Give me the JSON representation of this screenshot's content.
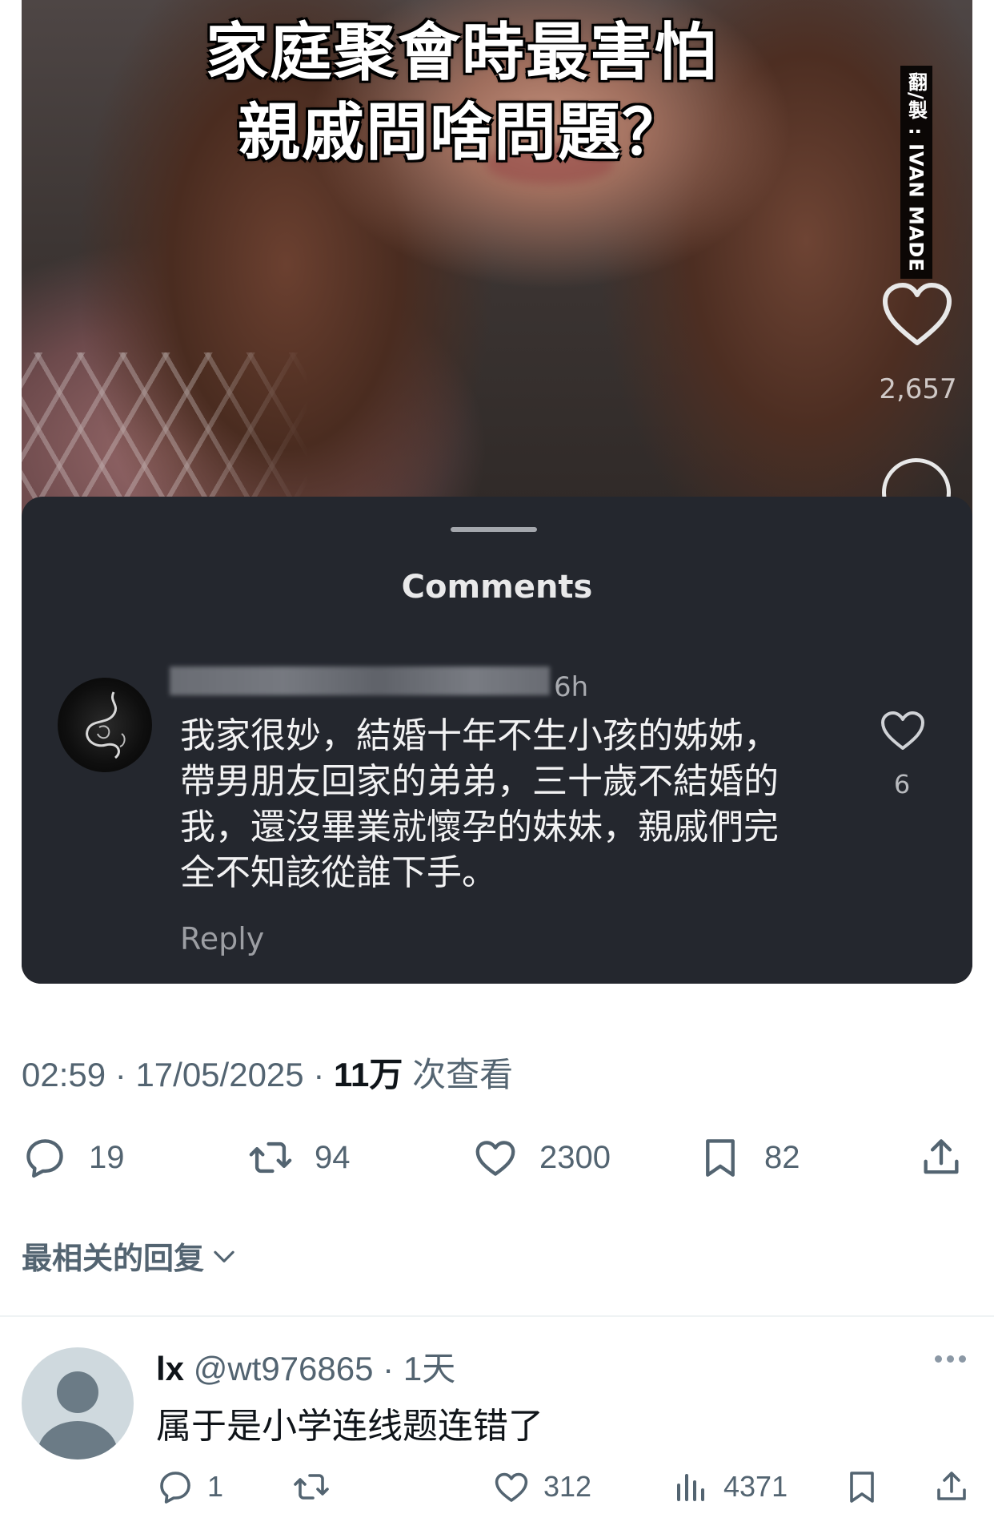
{
  "media": {
    "headline_line1": "家庭聚會時最害怕",
    "headline_line2": "親戚問啥問題？",
    "credit": "翻/製 : IVAN MADE",
    "side_like_count": "2,657",
    "sheet": {
      "title": "Comments",
      "comment": {
        "time": "6h",
        "lines": [
          "我家很妙，結婚十年不生小孩的姊姊，",
          "帶男朋友回家的弟弟，三十歲不結婚的",
          "我，還沒畢業就懷孕的妹妹，親戚們完",
          "全不知該從誰下手。"
        ],
        "likes": "6",
        "reply_label": "Reply"
      }
    }
  },
  "tweet": {
    "time": "02:59",
    "date": "17/05/2025",
    "views_count": "11万",
    "views_label": "次查看",
    "replies": "19",
    "retweets": "94",
    "likes": "2300",
    "bookmarks": "82"
  },
  "sort_label": "最相关的回复",
  "reply": {
    "name": "lx",
    "handle": "@wt976865",
    "age": "1天",
    "text": "属于是小学连线题连错了",
    "replies": "1",
    "likes": "312",
    "views": "4371"
  },
  "colors": {
    "text_primary": "#0f1419",
    "text_secondary": "#536471",
    "sheet_bg": "#24272e",
    "divider": "#eff3f4"
  }
}
